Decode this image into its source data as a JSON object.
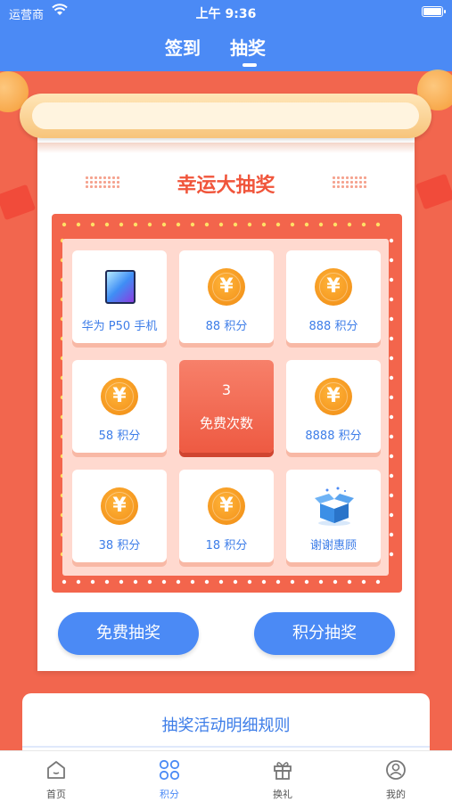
{
  "status_bar": {
    "carrier": "运营商",
    "time": "上午 9:36"
  },
  "tabs": [
    {
      "label": "签到"
    },
    {
      "label": "抽奖"
    }
  ],
  "active_tab": "抽奖",
  "title": "幸运大抽奖",
  "prizes": [
    {
      "label": "华为 P50 手机",
      "icon": "phone-icon"
    },
    {
      "label": "88 积分",
      "icon": "coin-icon"
    },
    {
      "label": "888 积分",
      "icon": "coin-icon"
    },
    {
      "label": "58 积分",
      "icon": "coin-icon"
    },
    {
      "label": "8888 积分",
      "icon": "coin-icon"
    },
    {
      "label": "38 积分",
      "icon": "coin-icon"
    },
    {
      "label": "18 积分",
      "icon": "coin-icon"
    },
    {
      "label": "谢谢惠顾",
      "icon": "empty-box-icon"
    }
  ],
  "coin_symbol": "¥",
  "free_draws": {
    "count": "3",
    "label": "免费次数"
  },
  "buttons": {
    "free_draw": "免费抽奖",
    "points_draw": "积分抽奖"
  },
  "rules_title": "抽奖活动明细规则",
  "nav": [
    {
      "label": "首页",
      "icon": "home-icon"
    },
    {
      "label": "积分",
      "icon": "grid-icon"
    },
    {
      "label": "换礼",
      "icon": "gift-icon"
    },
    {
      "label": "我的",
      "icon": "profile-icon"
    }
  ],
  "active_nav": "积分",
  "colors": {
    "primary_blue": "#4b8af5",
    "background_red": "#f2664e",
    "coin_orange": "#f59a1e",
    "title_red": "#f0553b"
  }
}
